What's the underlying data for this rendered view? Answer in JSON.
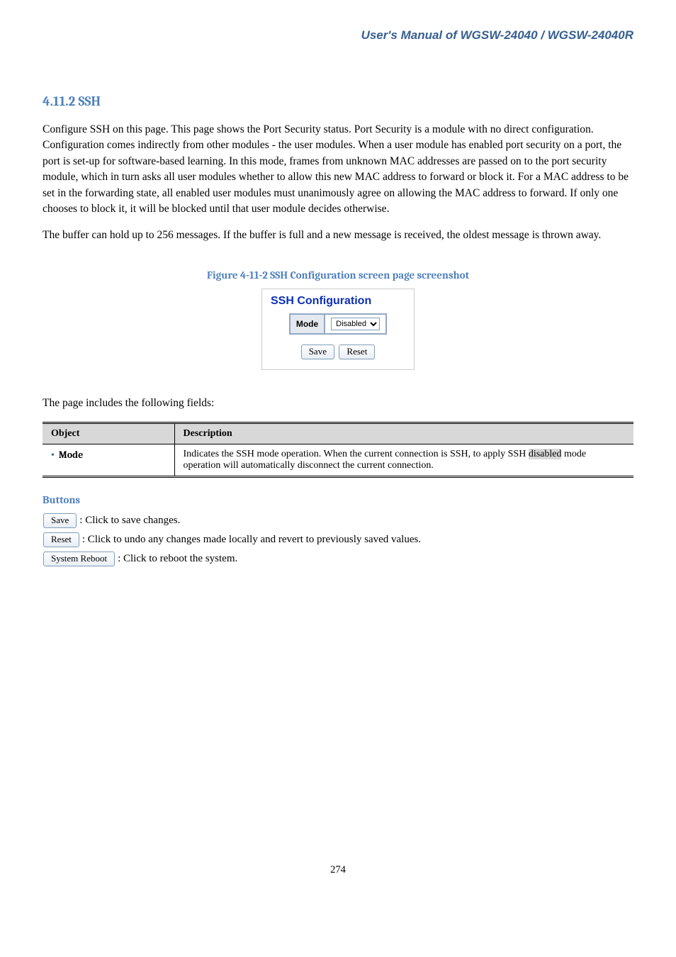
{
  "chapter_title": "User's Manual of WGSW-24040 / WGSW-24040R",
  "section": "4.11.2 SSH",
  "intro": "Configure SSH on this page. This page shows the Port Security status. Port Security is a module with no direct configuration. Configuration comes indirectly from other modules - the user modules. When a user module has enabled port security on a port, the port is set-up for software-based learning. In this mode, frames from unknown MAC addresses are passed on to the port security module, which in turn asks all user modules whether to allow this new MAC address to forward or block it. For a MAC address to be set in the forwarding state, all enabled user modules must unanimously agree on allowing the MAC address to forward. If only one chooses to block it, it will be blocked until that user module decides otherwise.",
  "intro2": "The buffer can hold up to 256 messages. If the buffer is full and a new message is received, the oldest message is thrown away.",
  "figure_caption": "Figure 4-11-2 SSH Configuration screen page screenshot",
  "panel": {
    "title": "SSH Configuration",
    "mode_label": "Mode",
    "mode_value": "Disabled",
    "save_label": "Save",
    "reset_label": "Reset"
  },
  "page_includes": "The page includes the following fields:",
  "table": {
    "head_object": "Object",
    "head_description": "Description",
    "row": {
      "object": "Mode",
      "desc_prefix": "Indicates the SSH mode operation. When the current connection is SSH, to apply SSH ",
      "disabled": "disabled",
      "desc_suffix": " mode operation will automatically disconnect the current connection."
    }
  },
  "buttons": {
    "heading": "Buttons",
    "save_label": "Save",
    "save_desc": ": Click to save changes.",
    "reset_label": "Reset",
    "reset_desc": ": Click to undo any changes made locally and revert to previously saved values.",
    "sys_reboot_label": "System Reboot",
    "sys_reboot_desc": ": Click to reboot the system."
  },
  "page_number": "274"
}
